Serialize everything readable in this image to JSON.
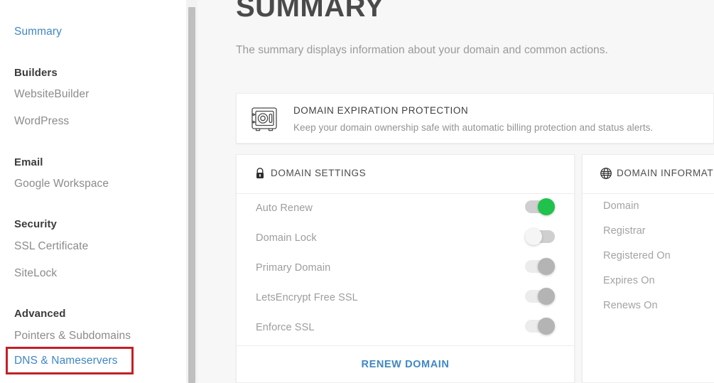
{
  "sidebar": {
    "summary_link": "Summary",
    "groups": [
      {
        "heading": "Builders",
        "items": [
          "WebsiteBuilder",
          "WordPress"
        ]
      },
      {
        "heading": "Email",
        "items": [
          "Google Workspace"
        ]
      },
      {
        "heading": "Security",
        "items": [
          "SSL Certificate",
          "SiteLock"
        ]
      },
      {
        "heading": "Advanced",
        "items": [
          "Pointers & Subdomains",
          "DNS & Nameservers"
        ]
      }
    ],
    "highlighted_item": "DNS & Nameservers",
    "highlight_color": "#c32026",
    "link_color": "#3f87c5"
  },
  "main": {
    "title": "SUMMARY",
    "subtitle": "The summary displays information about your domain and common actions.",
    "protection_banner": {
      "icon": "safe-vault-icon",
      "title": "DOMAIN EXPIRATION PROTECTION",
      "description": "Keep your domain ownership safe with automatic billing protection and status alerts."
    },
    "domain_settings_card": {
      "icon": "lock-icon",
      "title": "DOMAIN SETTINGS",
      "rows": [
        {
          "label": "Auto Renew",
          "state": "on"
        },
        {
          "label": "Domain Lock",
          "state": "off"
        },
        {
          "label": "Primary Domain",
          "state": "dim"
        },
        {
          "label": "LetsEncrypt Free SSL",
          "state": "dim"
        },
        {
          "label": "Enforce SSL",
          "state": "dim"
        }
      ],
      "renew_button": "RENEW DOMAIN",
      "toggle_on_color": "#1fc24a"
    },
    "domain_information_card": {
      "icon": "globe-icon",
      "title": "DOMAIN INFORMATION",
      "rows": [
        "Domain",
        "Registrar",
        "Registered On",
        "Expires On",
        "Renews On"
      ]
    }
  }
}
